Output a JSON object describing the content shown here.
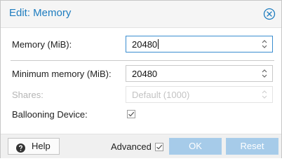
{
  "dialog": {
    "title": "Edit: Memory",
    "close_icon": "close-circle-icon"
  },
  "form": {
    "memory": {
      "label": "Memory (MiB):",
      "value": "20480"
    },
    "minimum_memory": {
      "label": "Minimum memory (MiB):",
      "value": "20480"
    },
    "shares": {
      "label": "Shares:",
      "placeholder": "Default (1000)",
      "disabled": true
    },
    "ballooning": {
      "label": "Ballooning Device:",
      "checked": true
    }
  },
  "footer": {
    "help_label": "Help",
    "help_icon": "question-circle-icon",
    "advanced_label": "Advanced",
    "advanced_checked": true,
    "ok_label": "OK",
    "reset_label": "Reset"
  },
  "colors": {
    "title": "#1d7cbf",
    "primary_button": "#a6cbe9",
    "focus_border": "#3a8dd0"
  }
}
